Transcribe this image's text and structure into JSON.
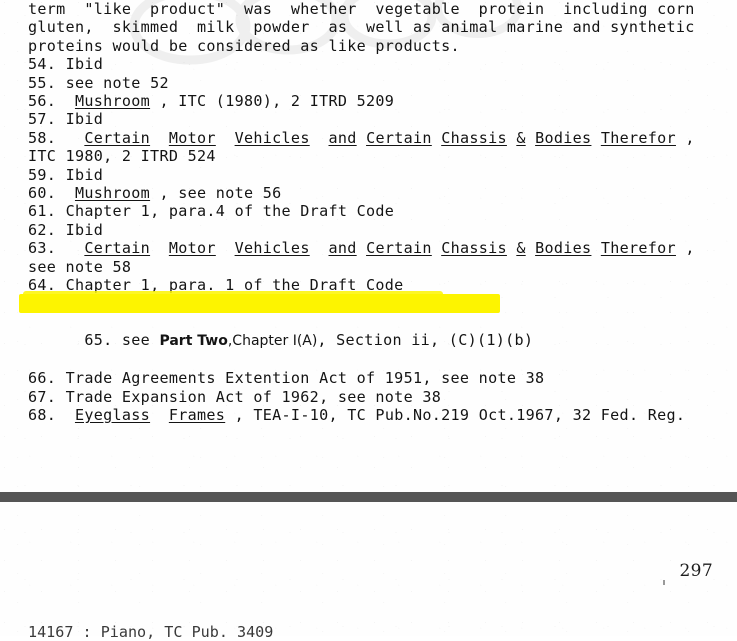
{
  "document": {
    "type": "scanned-page",
    "page_number": "297",
    "highlight_color": "#fdf400",
    "separator_color": "#555555"
  },
  "paragraph": {
    "lines": [
      "term  \"like  product\"  was  whether  vegetable  protein  including corn",
      "gluten,  skimmed  milk  powder  as  well as animal marine and synthetic",
      "proteins would be considered as like products."
    ]
  },
  "footnotes": [
    {
      "number": "54.",
      "text": "Ibid"
    },
    {
      "number": "55.",
      "text": "see note 52"
    },
    {
      "number": "56.",
      "italic_title": "Mushroom",
      "text": " , ITC (1980), 2 ITRD 5209"
    },
    {
      "number": "57.",
      "text": "Ibid"
    },
    {
      "number": "58.",
      "case_words": [
        "Certain",
        "Motor",
        "Vehicles",
        "and",
        "Certain",
        "Chassis",
        "&",
        "Bodies",
        "Therefor"
      ],
      "tail": " ,",
      "continuation": "ITC 1980, 2 ITRD 524"
    },
    {
      "number": "59.",
      "text": "Ibid"
    },
    {
      "number": "60.",
      "italic_title": "Mushroom",
      "text": " , see note 56"
    },
    {
      "number": "61.",
      "text": "Chapter 1, para.4 of the Draft Code"
    },
    {
      "number": "62.",
      "text": "Ibid"
    },
    {
      "number": "63.",
      "case_words": [
        "Certain",
        "Motor",
        "Vehicles",
        "and",
        "Certain",
        "Chassis",
        "&",
        "Bodies",
        "Therefor"
      ],
      "tail": " ,",
      "continuation": "see note 58"
    },
    {
      "number": "64.",
      "text": "Chapter 1, para. 1 of the Draft Code"
    },
    {
      "number": "65.",
      "highlighted": true,
      "prefix": "see ",
      "emphasis_a": "Part Two",
      "emphasis_b": ",Chapter I(A)",
      "suffix": ", Section ii, (C)(1)(b)"
    },
    {
      "number": "66.",
      "text": "Trade Agreements Extention Act of 1951, see note 38"
    },
    {
      "number": "67.",
      "text": "Trade Expansion Act of 1962, see note 38"
    },
    {
      "number": "68.",
      "italic_title_a": "Eyeglass",
      "italic_title_b": "Frames",
      "text": " , TEA-I-10, TC Pub.No.219 Oct.1967, 32 Fed. Reg."
    }
  ],
  "footer": {
    "clipped_line": "14167 : Piano, TC Pub. 3409"
  }
}
